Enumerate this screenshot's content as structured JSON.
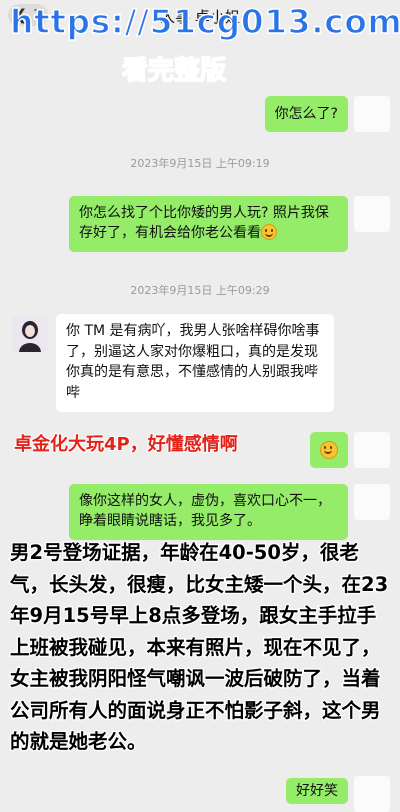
{
  "header": {
    "back_count": "1",
    "title": "人事 卓小姐",
    "more": "···"
  },
  "watermark": {
    "url": "https://51cg013.com",
    "subtitle": "看完整版"
  },
  "messages": [
    {
      "from": "me",
      "text": "你怎么了?"
    },
    {
      "timestamp": "2023年9月15日 上午09:19"
    },
    {
      "from": "me",
      "text": "你怎么找了个比你矮的男人玩? 照片我保存好了，有机会给你老公看看",
      "emoji": "smile"
    },
    {
      "timestamp": "2023年9月15日 上午09:29"
    },
    {
      "from": "them",
      "text": "你 TM 是有病吖，我男人张啥样碍你啥事了，别逼这人家对你爆粗口，真的是发现你真的是有意思，不懂感情的人别跟我哔哔"
    },
    {
      "from": "me",
      "emoji": "smile"
    },
    {
      "from": "me",
      "text": "像你这样的女人，虚伪，喜欢口心不一，睁着眼睛说瞎话，我见多了。"
    },
    {
      "from": "me",
      "text": "好好笑"
    }
  ],
  "overlay": {
    "red_caption": "卓金化大玩4P，好懂感情啊",
    "note": "男2号登场证据，年龄在40-50岁，很老气，长头发，很瘦，比女主矮一个头，在23年9月15号早上8点多登场，跟女主手拉手上班被我碰见，本来有照片，现在不见了，女主被我阴阳怪气嘲讽一波后破防了，当着公司所有人的面说身正不怕影子斜，这个男的就是她老公。"
  },
  "colors": {
    "sent_bubble": "#95ec69",
    "received_bubble": "#ffffff",
    "background": "#ededed",
    "watermark": "#2a74e6",
    "red_caption": "#e2231a"
  }
}
